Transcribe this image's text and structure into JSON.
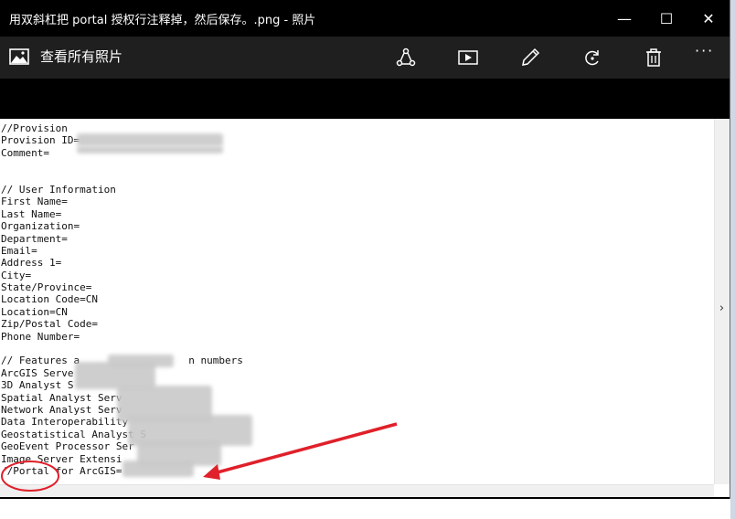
{
  "window": {
    "title": "用双斜杠把 portal 授权行注释掉，然后保存。.png - 照片",
    "controls": {
      "minimize": "—",
      "maximize": "☐",
      "close": "✕"
    }
  },
  "toolbar": {
    "back_label": "查看所有照片",
    "tools": [
      "share-icon",
      "slideshow-icon",
      "edit-icon",
      "rotate-icon",
      "delete-icon"
    ],
    "more": "···"
  },
  "photo": {
    "lines": [
      "//Provision",
      "Provision ID=",
      "Comment=",
      "",
      "",
      "// User Information",
      "First Name=",
      "Last Name=",
      "Organization=",
      "Department=",
      "Email=",
      "Address 1=",
      "City=",
      "State/Province=",
      "Location Code=CN",
      "Location=CN",
      "Zip/Postal Code=",
      "Phone Number=",
      "",
      "// Features a                  n numbers",
      "ArcGIS Serve",
      "3D Analyst S",
      "Spatial Analyst Serv",
      "Network Analyst Serv",
      "Data Interoperability",
      "Geostatistical Analyst S",
      "GeoEvent Processor Ser",
      "Image Server Extensi",
      "//Portal for ArcGIS="
    ],
    "nav_next": "›"
  },
  "colors": {
    "annotation": "#e0202a",
    "toolbar_bg": "#1f1f1f",
    "titlebar_bg": "#000000"
  }
}
